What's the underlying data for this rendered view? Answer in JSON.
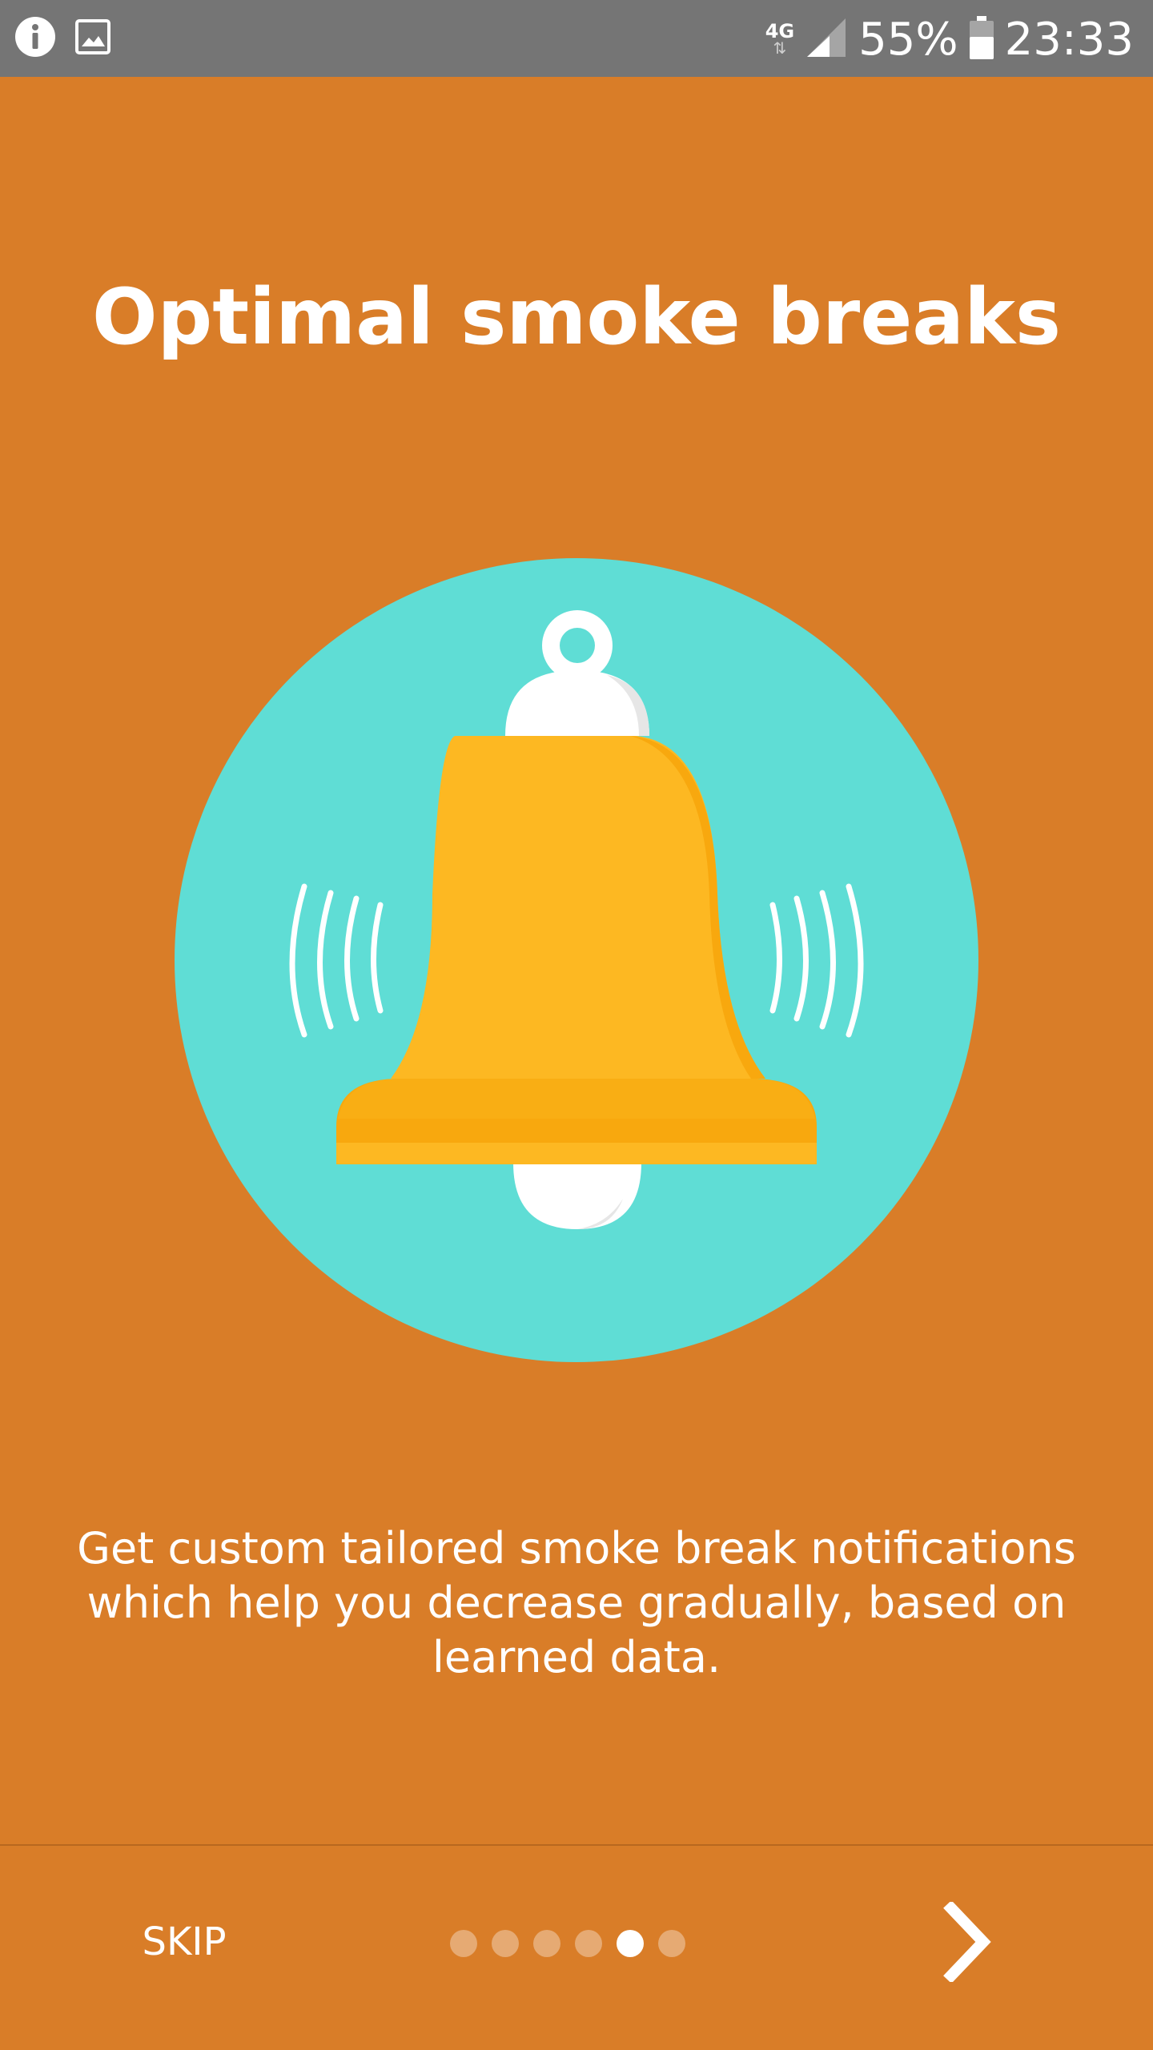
{
  "status_bar": {
    "icons_left": [
      "info-icon",
      "image-icon"
    ],
    "network_type": "4G",
    "battery_percent": "55%",
    "time": "23:33"
  },
  "onboarding": {
    "title": "Optimal smoke breaks",
    "illustration": "bell-icon",
    "description": "Get custom tailored smoke break notifications which help you decrease gradually, based on learned data.",
    "skip_label": "SKIP",
    "page_count": 6,
    "current_page": 5,
    "next_icon": "chevron-right-icon"
  },
  "colors": {
    "background": "#D97D28",
    "status_bar": "#757575",
    "circle": "#5FDDD5",
    "bell": "#FDB822",
    "bell_shade": "#F8A80E",
    "white": "#FFFFFF"
  }
}
